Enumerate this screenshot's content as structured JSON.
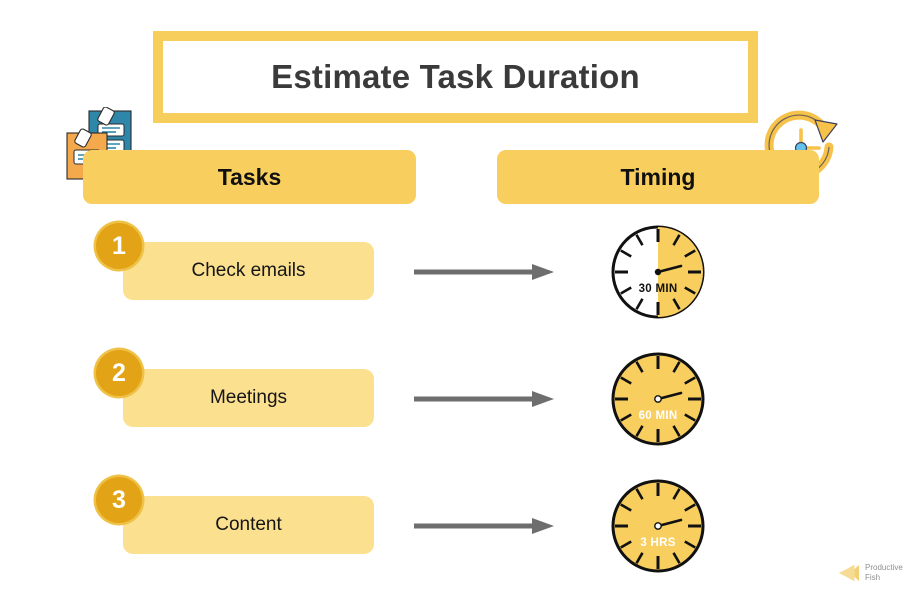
{
  "title": "Estimate Task Duration",
  "decor": {
    "notes_icon": "sticky-notes-icon",
    "cycle_clock_icon": "clock-refresh-icon"
  },
  "columns": {
    "tasks_label": "Tasks",
    "timing_label": "Timing"
  },
  "rows": [
    {
      "step": "1",
      "task": "Check emails",
      "arrow": "arrow-right-icon",
      "clock": {
        "label": "30 MIN",
        "fill_percent": 50,
        "face_color": "#FFFFFF",
        "fill_color": "#F8CE5F",
        "label_color": "#111111"
      }
    },
    {
      "step": "2",
      "task": "Meetings",
      "arrow": "arrow-right-icon",
      "clock": {
        "label": "60 MIN",
        "fill_percent": 100,
        "face_color": "#F8CE5F",
        "fill_color": "#F8CE5F",
        "label_color": "#FFFFFF"
      }
    },
    {
      "step": "3",
      "task": "Content",
      "arrow": "arrow-right-icon",
      "clock": {
        "label": "3 HRS",
        "fill_percent": 100,
        "face_color": "#F8CE5F",
        "fill_color": "#F8CE5F",
        "label_color": "#FFFFFF"
      }
    }
  ],
  "watermark": {
    "line1": "Productive",
    "line2": "Fish",
    "logo": "fish-logo-icon"
  },
  "colors": {
    "header_gold": "#F8CE5F",
    "pill_yellow": "#FBE08F",
    "badge_gold": "#E2A317",
    "badge_ring": "#EFC247",
    "title_border": "#F7CE5B",
    "arrow_gray": "#6E6E6E",
    "text_dark": "#3A3A3A"
  }
}
